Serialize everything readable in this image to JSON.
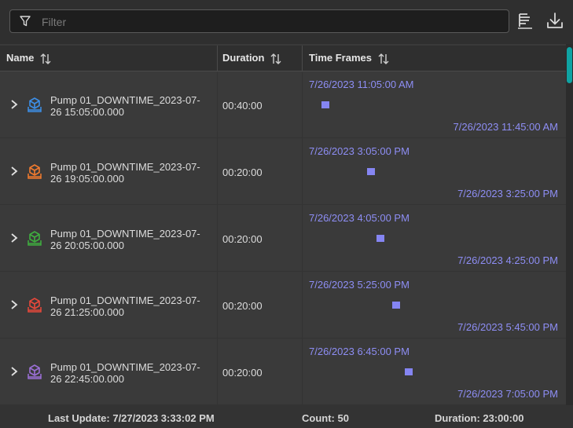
{
  "filter": {
    "placeholder": "Filter",
    "value": ""
  },
  "toolbar": {
    "columns_icon": "column-chooser-icon",
    "download_icon": "download-icon"
  },
  "columns": [
    {
      "label": "Name"
    },
    {
      "label": "Duration"
    },
    {
      "label": "Time Frames"
    }
  ],
  "rows": [
    {
      "name": "Pump 01_DOWNTIME_2023-07-26 15:05:00.000",
      "duration": "00:40:00",
      "start": "7/26/2023 11:05:00 AM",
      "end": "7/26/2023 11:45:00 AM",
      "icon_color": "#3d8fe8",
      "bar_position": 0.05
    },
    {
      "name": "Pump 01_DOWNTIME_2023-07-26 19:05:00.000",
      "duration": "00:20:00",
      "start": "7/26/2023 3:05:00 PM",
      "end": "7/26/2023 3:25:00 PM",
      "icon_color": "#f07a2e",
      "bar_position": 0.23
    },
    {
      "name": "Pump 01_DOWNTIME_2023-07-26 20:05:00.000",
      "duration": "00:20:00",
      "start": "7/26/2023 4:05:00 PM",
      "end": "7/26/2023 4:25:00 PM",
      "icon_color": "#3fae3f",
      "bar_position": 0.27
    },
    {
      "name": "Pump 01_DOWNTIME_2023-07-26 21:25:00.000",
      "duration": "00:20:00",
      "start": "7/26/2023 5:25:00 PM",
      "end": "7/26/2023 5:45:00 PM",
      "icon_color": "#e8483a",
      "bar_position": 0.33
    },
    {
      "name": "Pump 01_DOWNTIME_2023-07-26 22:45:00.000",
      "duration": "00:20:00",
      "start": "7/26/2023 6:45:00 PM",
      "end": "7/26/2023 7:05:00 PM",
      "icon_color": "#9b6fd6",
      "bar_position": 0.38
    }
  ],
  "footer": {
    "last_update": "Last Update: 7/27/2023 3:33:02 PM",
    "count": "Count: 50",
    "duration": "Duration: 23:00:00"
  }
}
